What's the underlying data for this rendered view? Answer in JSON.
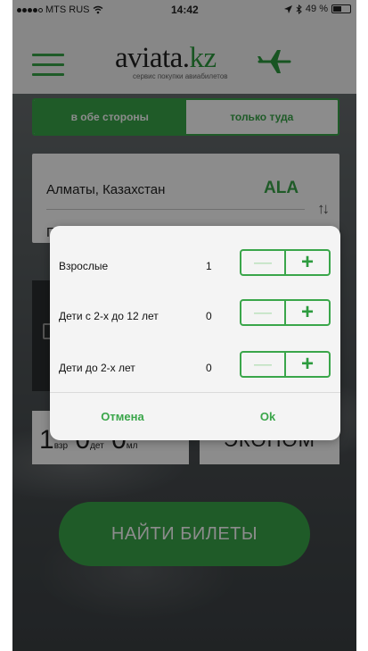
{
  "status_bar": {
    "carrier": "MTS RUS",
    "time": "14:42",
    "battery": "49 %"
  },
  "header": {
    "logo_main": "aviata.",
    "logo_kz": "kz",
    "logo_sub": "сервис покупки авиабилетов"
  },
  "trip_type": {
    "options": [
      {
        "label": "в обе стороны",
        "active": true
      },
      {
        "label": "только туда",
        "active": false
      }
    ]
  },
  "route": {
    "from_city": "Алматы, Казахстан",
    "from_code": "ALA",
    "to_city": "Г"
  },
  "passengers_summary": {
    "adults": "1",
    "adults_unit": "взр",
    "children": "0",
    "children_unit": "дет",
    "infants": "0",
    "infants_unit": "мл"
  },
  "cabin_class": "ЭКОНОМ",
  "search_button": "НАЙТИ БИЛЕТЫ",
  "passengers_dialog": {
    "rows": [
      {
        "label": "Взрослые",
        "count": "1"
      },
      {
        "label": "Дети с 2-х до 12 лет",
        "count": "0"
      },
      {
        "label": "Дети до 2-х лет",
        "count": "0"
      }
    ],
    "cancel": "Отмена",
    "ok": "Ok"
  },
  "colors": {
    "brand_green": "#3aa64a",
    "disabled_green": "#b7dfb9"
  }
}
